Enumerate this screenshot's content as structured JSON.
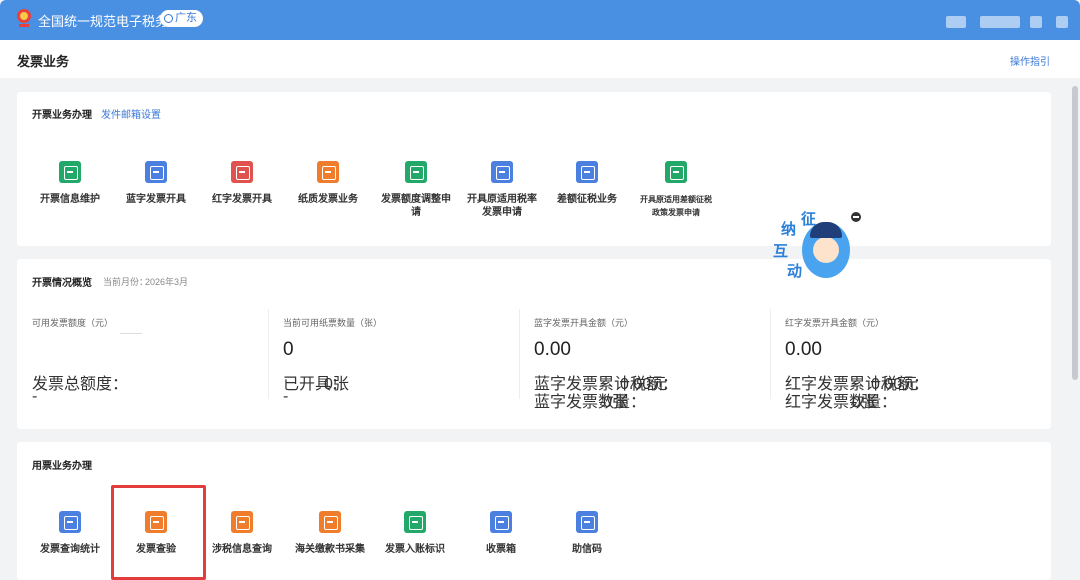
{
  "header": {
    "site_title": "全国统一规范电子税务局",
    "region": "广东"
  },
  "page": {
    "title": "发票业务",
    "guide_link": "操作指引"
  },
  "issuing_section": {
    "title": "开票业务办理",
    "link": "发件邮箱设置",
    "tiles": [
      {
        "label": "开票信息维护",
        "icon": "invoice-info-icon",
        "color": "#22a96a"
      },
      {
        "label": "蓝字发票开具",
        "icon": "blue-invoice-icon",
        "color": "#4b7fe0"
      },
      {
        "label": "红字发票开具",
        "icon": "red-invoice-icon",
        "color": "#e0524d"
      },
      {
        "label": "纸质发票业务",
        "icon": "paper-invoice-icon",
        "color": "#ef7d2c"
      },
      {
        "label": "发票额度调整申请",
        "icon": "quota-adjust-icon",
        "color": "#22a96a"
      },
      {
        "label": "开具原适用税率发票申请",
        "icon": "original-rate-icon",
        "color": "#4b7fe0"
      },
      {
        "label": "差额征税业务",
        "icon": "differential-tax-icon",
        "color": "#4b7fe0"
      },
      {
        "label": "开具原适用差额征税政策发票申请",
        "icon": "differential-policy-icon",
        "color": "#22a96a"
      }
    ]
  },
  "overview_section": {
    "title": "开票情况概览",
    "current_month_label": "当前月份：",
    "current_month": "2026年3月",
    "stats": [
      {
        "label": "可用发票额度（元）",
        "value": "",
        "detail1": "发票总额度：",
        "detail1_value": "-"
      },
      {
        "label": "当前可用纸票数量（张）",
        "value": "0",
        "detail1": "已开具：",
        "detail1_value": "0张",
        "detail2_value": "-"
      },
      {
        "label": "蓝字发票开具金额（元）",
        "value": "0.00",
        "detail1": "蓝字发票累计税额：",
        "detail1_value": "0.00元",
        "detail2": "蓝字发票数量：",
        "detail2_value": "0张"
      },
      {
        "label": "红字发票开具金额（元）",
        "value": "0.00",
        "detail1": "红字发票累计税额：",
        "detail1_value": "0.00元",
        "detail2": "红字发票数量：",
        "detail2_value": "0张"
      }
    ]
  },
  "usage_section": {
    "title": "用票业务办理",
    "tiles": [
      {
        "label": "发票查询统计",
        "icon": "invoice-search-icon",
        "color": "#4b7fe0"
      },
      {
        "label": "发票查验",
        "icon": "invoice-verify-icon",
        "color": "#ef7d2c"
      },
      {
        "label": "涉税信息查询",
        "icon": "tax-info-icon",
        "color": "#ef7d2c"
      },
      {
        "label": "海关缴款书采集",
        "icon": "customs-payment-icon",
        "color": "#ef7d2c"
      },
      {
        "label": "发票入账标识",
        "icon": "invoice-booking-icon",
        "color": "#22a96a"
      },
      {
        "label": "收票箱",
        "icon": "mailbox-icon",
        "color": "#4b7fe0"
      },
      {
        "label": "助信码",
        "icon": "qr-code-icon",
        "color": "#4b7fe0"
      }
    ]
  },
  "mascot": {
    "chars": [
      "征",
      "纳",
      "互",
      "动"
    ]
  }
}
